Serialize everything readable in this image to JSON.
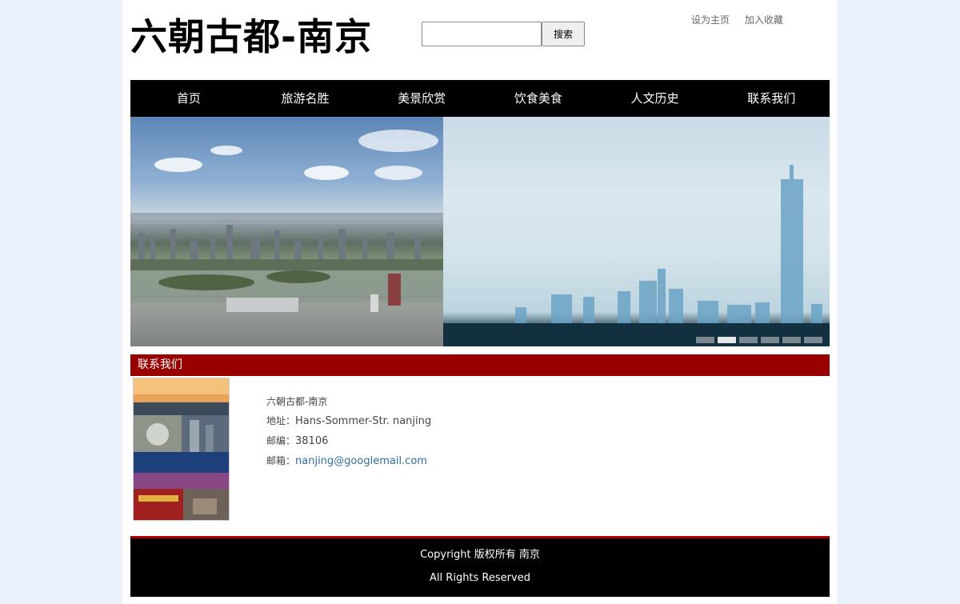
{
  "header": {
    "logo_text": "六朝古都-南京",
    "search": {
      "value": "",
      "placeholder": "",
      "button_label": "搜索"
    },
    "links": [
      {
        "label": "设为主页"
      },
      {
        "label": "加入收藏"
      }
    ]
  },
  "nav": {
    "items": [
      {
        "label": "首页"
      },
      {
        "label": "旅游名胜"
      },
      {
        "label": "美景欣赏"
      },
      {
        "label": "饮食美食"
      },
      {
        "label": "人文历史"
      },
      {
        "label": "联系我们"
      }
    ]
  },
  "banner": {
    "slide_count": 6,
    "active_slide": 2
  },
  "contact": {
    "section_title": "联系我们",
    "name": "六朝古都-南京",
    "address_label": "地址：",
    "address_value": "Hans-Sommer-Str. nanjing",
    "postcode_label": "邮编：",
    "postcode_value": "38106",
    "email_label": "邮箱：",
    "email_value": "nanjing@googlemail.com"
  },
  "footer": {
    "line1": "Copyright 版权所有 南京",
    "line2": "All Rights Reserved"
  },
  "colors": {
    "page_background": "#eaf1fb",
    "nav_background": "#000000",
    "section_bar": "#990000",
    "footer_border": "#b00000",
    "link": "#2f6fa5"
  }
}
